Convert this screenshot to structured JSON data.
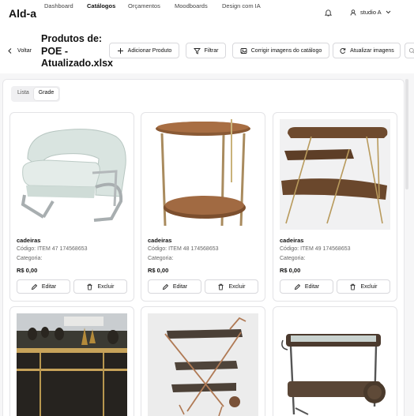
{
  "app": {
    "logo": "Ald-a"
  },
  "nav": {
    "items": [
      "Dashboard",
      "Catálogos",
      "Orçamentos",
      "Moodboards",
      "Design com IA"
    ],
    "active": "Catálogos"
  },
  "user": {
    "name": "studio A"
  },
  "toolbar": {
    "back_label": "Voltar",
    "title": "Produtos de: POE - Atualizado.xlsx",
    "add_label": "Adicionar Produto",
    "filter_label": "Filtrar",
    "fix_images_label": "Corrigir imagens do catálogo",
    "refresh_images_label": "Atualizar imagens"
  },
  "view_tabs": {
    "list": "Lista",
    "grid": "Grade",
    "active": "Grade"
  },
  "products": [
    {
      "name": "cadeiras",
      "code": "Código: ITEM 47 174568653",
      "category": "Categoria:",
      "price": "R$ 0,00",
      "image": "armchair"
    },
    {
      "name": "cadeiras",
      "code": "Código: ITEM 48 174568653",
      "category": "Categoria:",
      "price": "R$ 0,00",
      "image": "round-side-table"
    },
    {
      "name": "cadeiras",
      "code": "Código: ITEM 49 174568653",
      "category": "Categoria:",
      "price": "R$ 0,00",
      "image": "tiered-trays"
    },
    {
      "name": "",
      "code": "",
      "category": "",
      "price": "",
      "image": "bar-display"
    },
    {
      "name": "",
      "code": "",
      "category": "",
      "price": "",
      "image": "bar-cart"
    },
    {
      "name": "",
      "code": "",
      "category": "",
      "price": "",
      "image": "serving-cart"
    }
  ],
  "card_actions": {
    "edit": "Editar",
    "delete": "Excluir"
  },
  "colors": {
    "accent": "#111111",
    "border": "#e3e3e6",
    "wood": "#8a5a35"
  }
}
